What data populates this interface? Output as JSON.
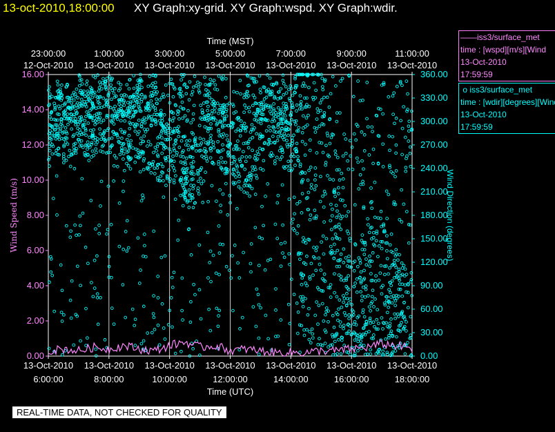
{
  "header": {
    "datetime": "13-oct-2010,18:00:00",
    "graphs": "XY Graph:xy-grid.  XY Graph:wspd.  XY Graph:wdir."
  },
  "legend": {
    "wspd": {
      "name": "iss3/surface_met",
      "var": "time : [wspd][m/s][Wind",
      "date": "13-Oct-2010",
      "time": "17:59:59",
      "color": "#ff88ff"
    },
    "wdir": {
      "name": "iss3/surface_met",
      "var": "time : [wdir][degrees][Wind",
      "date": "13-Oct-2010",
      "time": "17:59:59",
      "color": "#00ffff"
    }
  },
  "footer": "REAL-TIME DATA, NOT CHECKED FOR QUALITY",
  "chart_data": {
    "type": "scatter",
    "top_axis": {
      "label": "Time (MST)",
      "ticks": [
        {
          "time": "23:00:00",
          "date": "12-Oct-2010"
        },
        {
          "time": "1:00:00",
          "date": "13-Oct-2010"
        },
        {
          "time": "3:00:00",
          "date": "13-Oct-2010"
        },
        {
          "time": "5:00:00",
          "date": "13-Oct-2010"
        },
        {
          "time": "7:00:00",
          "date": "13-Oct-2010"
        },
        {
          "time": "9:00:00",
          "date": "13-Oct-2010"
        },
        {
          "time": "11:00:00",
          "date": "13-Oct-2010"
        }
      ]
    },
    "bottom_axis": {
      "label": "Time (UTC)",
      "xlim": [
        "2010-10-13 06:00",
        "2010-10-13 18:00"
      ],
      "ticks": [
        {
          "date": "13-Oct-2010",
          "time": "6:00:00"
        },
        {
          "date": "13-Oct-2010",
          "time": "8:00:00"
        },
        {
          "date": "13-Oct-2010",
          "time": "10:00:00"
        },
        {
          "date": "13-Oct-2010",
          "time": "12:00:00"
        },
        {
          "date": "13-Oct-2010",
          "time": "14:00:00"
        },
        {
          "date": "13-Oct-2010",
          "time": "16:00:00"
        },
        {
          "date": "13-Oct-2010",
          "time": "18:00:00"
        }
      ]
    },
    "left_axis": {
      "label": "Wind Speed (m/s)",
      "ylim": [
        0,
        16
      ],
      "ticks": [
        "0.00",
        "2.00",
        "4.00",
        "6.00",
        "8.00",
        "10.00",
        "12.00",
        "14.00",
        "16.00"
      ]
    },
    "right_axis": {
      "label": "Wind Direction (degrees)",
      "ylim": [
        0,
        360
      ],
      "ticks": [
        "0.00",
        "30.00",
        "60.00",
        "90.00",
        "120.00",
        "150.00",
        "180.00",
        "210.00",
        "240.00",
        "270.00",
        "300.00",
        "330.00",
        "360.00"
      ]
    },
    "grid": true,
    "series": [
      {
        "name": "iss3/surface_met time : [wspd][m/s][Wind",
        "style": "line",
        "axis": "left",
        "color": "#ff88ff",
        "x_hours_utc": [
          6.0,
          6.5,
          7.0,
          7.5,
          8.0,
          8.5,
          9.0,
          9.5,
          10.0,
          10.5,
          11.0,
          11.5,
          12.0,
          12.5,
          13.0,
          13.5,
          14.0,
          14.5,
          15.0,
          15.5,
          16.0,
          16.5,
          17.0,
          17.5,
          18.0
        ],
        "values": [
          0.3,
          0.4,
          0.3,
          0.5,
          0.4,
          0.6,
          0.4,
          0.3,
          0.6,
          0.8,
          0.5,
          0.6,
          0.3,
          0.4,
          0.3,
          0.2,
          0.2,
          0.2,
          0.3,
          0.3,
          0.4,
          0.5,
          0.7,
          0.6,
          0.4
        ]
      },
      {
        "name": "iss3/surface_met time : [wdir][degrees][Wind",
        "style": "markers",
        "axis": "right",
        "color": "#00ffff",
        "description_points_x_hours_utc": [
          6.0,
          6.3,
          6.6,
          7.0,
          7.3,
          7.6,
          8.0,
          8.3,
          8.6,
          9.0,
          9.3,
          9.6,
          10.0,
          10.3,
          10.6,
          11.0,
          11.3,
          11.6,
          12.0,
          12.3,
          12.6,
          13.0,
          13.3,
          13.6,
          14.0,
          14.3,
          14.6,
          15.0,
          15.3,
          15.6,
          16.0,
          16.3,
          16.6,
          17.0,
          17.3,
          17.6,
          18.0
        ],
        "values": [
          290,
          300,
          280,
          310,
          295,
          300,
          305,
          290,
          285,
          300,
          280,
          270,
          260,
          250,
          230,
          240,
          300,
          280,
          270,
          260,
          250,
          280,
          300,
          290,
          270,
          330,
          320,
          250,
          200,
          150,
          90,
          100,
          120,
          110,
          90,
          80,
          60
        ]
      }
    ]
  }
}
